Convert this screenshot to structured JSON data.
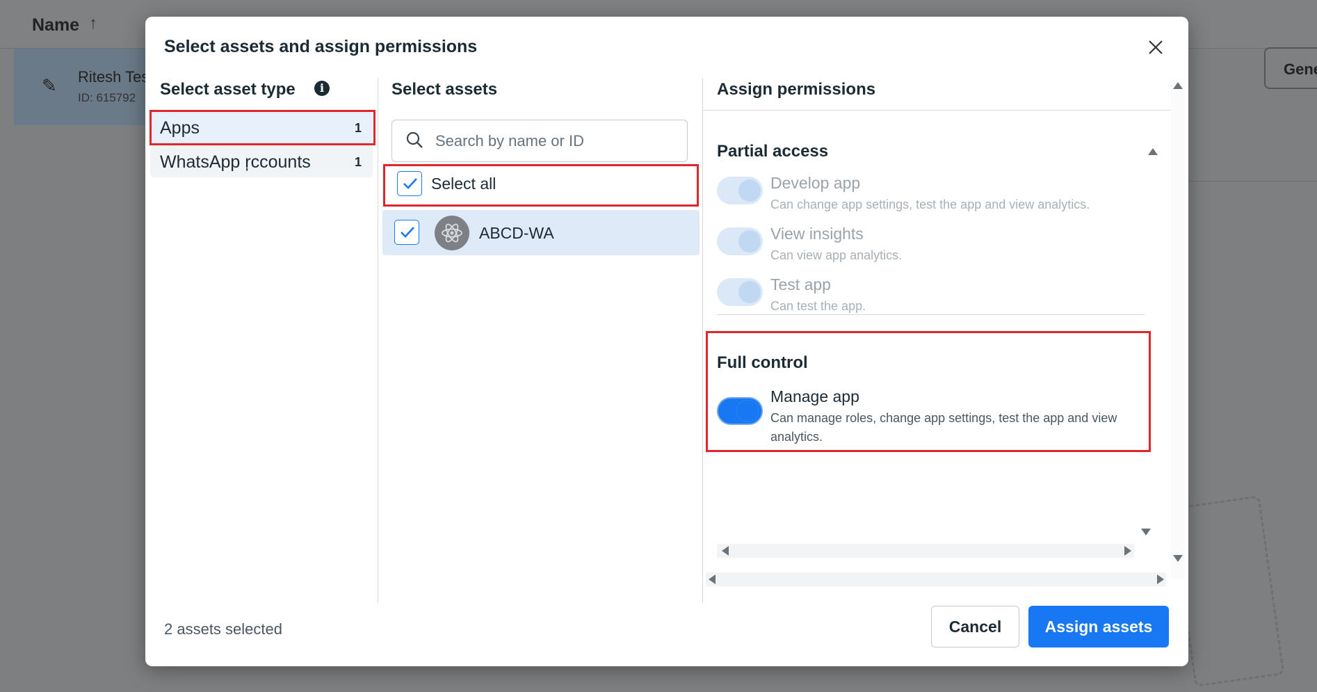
{
  "background": {
    "column_header": "Name",
    "row_name": "Ritesh Tes",
    "row_id": "ID: 615792",
    "right_button": "Gene"
  },
  "modal": {
    "title": "Select assets and assign permissions",
    "columns": {
      "asset_type": "Select asset type",
      "assets": "Select assets",
      "permissions": "Assign permissions"
    },
    "asset_types": [
      {
        "label": "Apps",
        "count": "1"
      },
      {
        "label": "WhatsApp ŗccounts",
        "count": "1"
      }
    ],
    "search": {
      "placeholder": "Search by name or ID"
    },
    "select_all": "Select all",
    "assets": [
      {
        "name": "ABCD-WA",
        "checked": true
      }
    ],
    "partial_access": {
      "title": "Partial access",
      "items": [
        {
          "title": "Develop app",
          "desc": "Can change app settings, test the app and view analytics."
        },
        {
          "title": "View insights",
          "desc": "Can view app analytics."
        },
        {
          "title": "Test app",
          "desc": "Can test the app."
        }
      ]
    },
    "full_control": {
      "title": "Full control",
      "items": [
        {
          "title": "Manage app",
          "desc": "Can manage roles, change app settings, test the app and view analytics."
        }
      ]
    },
    "footer": {
      "status": "2 assets selected",
      "cancel": "Cancel",
      "assign": "Assign assets"
    }
  },
  "colors": {
    "accent": "#1877f2",
    "highlight": "#e0252b",
    "selected_bg": "#e7f0fb"
  }
}
